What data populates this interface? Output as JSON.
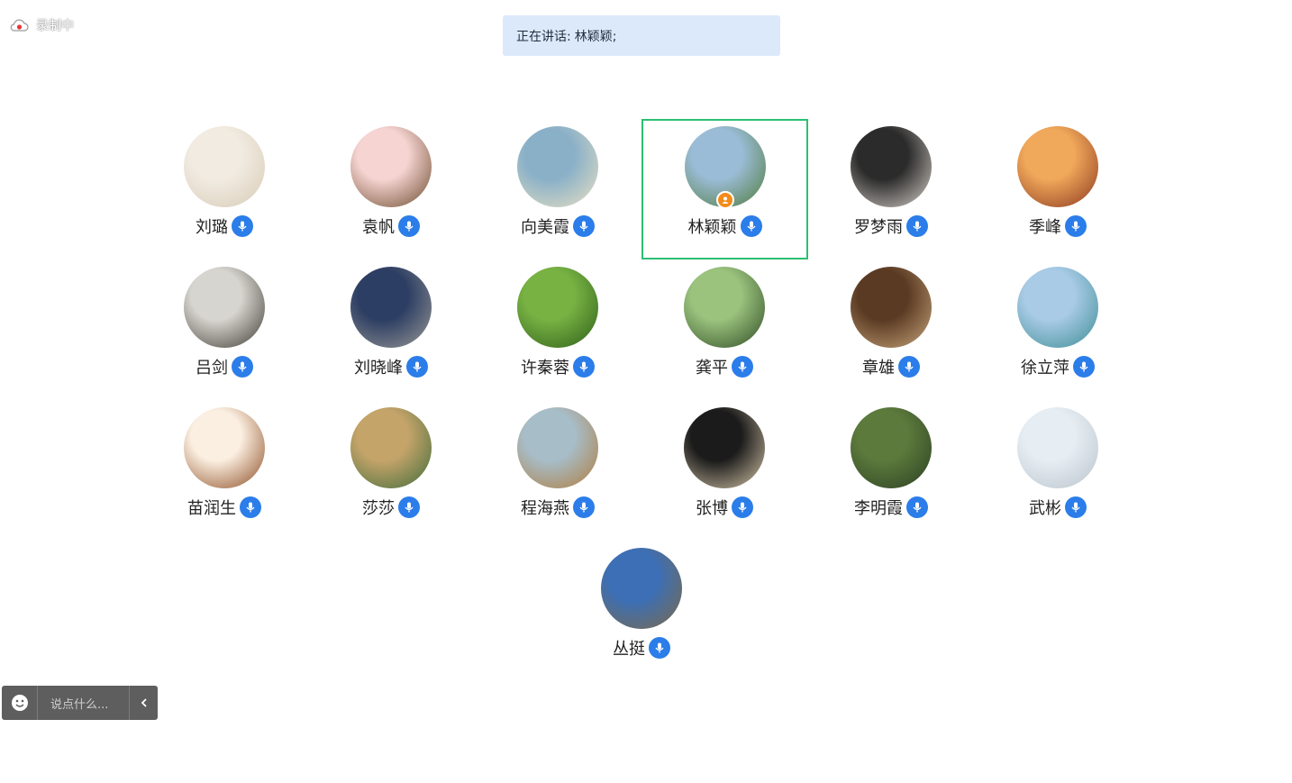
{
  "recording": {
    "label": "录制中",
    "icon": "cloud-record-icon"
  },
  "speaking": {
    "prefix": "正在讲话:",
    "names": "林颖颖;"
  },
  "participants": [
    {
      "name": "刘璐",
      "mic": "on",
      "colors": [
        "#f1ebe1",
        "#d8cbb6"
      ]
    },
    {
      "name": "袁帆",
      "mic": "on",
      "colors": [
        "#f6d4d2",
        "#6b4a2c"
      ]
    },
    {
      "name": "向美霞",
      "mic": "on",
      "colors": [
        "#8ab0c8",
        "#e9e1c2"
      ]
    },
    {
      "name": "林颖颖",
      "mic": "on",
      "host": true,
      "active": true,
      "colors": [
        "#9bbcd6",
        "#4e7a3a"
      ]
    },
    {
      "name": "罗梦雨",
      "mic": "on",
      "colors": [
        "#2b2b2b",
        "#d9d2cb"
      ]
    },
    {
      "name": "季峰",
      "mic": "on",
      "colors": [
        "#f0a85a",
        "#8a3720"
      ]
    },
    {
      "name": "吕剑",
      "mic": "on",
      "colors": [
        "#d7d5cf",
        "#3d3a32"
      ]
    },
    {
      "name": "刘晓峰",
      "mic": "on",
      "colors": [
        "#2c3e63",
        "#9c9a96"
      ]
    },
    {
      "name": "许秦蓉",
      "mic": "on",
      "colors": [
        "#78b243",
        "#2d5e1a"
      ]
    },
    {
      "name": "龚平",
      "mic": "on",
      "colors": [
        "#9bc37e",
        "#2e4a24"
      ]
    },
    {
      "name": "章雄",
      "mic": "on",
      "colors": [
        "#5a3a22",
        "#c9a77e"
      ]
    },
    {
      "name": "徐立萍",
      "mic": "on",
      "colors": [
        "#a9cbe6",
        "#3b8c93"
      ]
    },
    {
      "name": "苗润生",
      "mic": "on",
      "colors": [
        "#fbefe1",
        "#8a4a20"
      ]
    },
    {
      "name": "莎莎",
      "mic": "on",
      "colors": [
        "#c5a46a",
        "#3e6b3a"
      ]
    },
    {
      "name": "程海燕",
      "mic": "on",
      "colors": [
        "#a7bdc8",
        "#b07c3c"
      ]
    },
    {
      "name": "张博",
      "mic": "on",
      "colors": [
        "#1b1b1b",
        "#d9c8ab"
      ]
    },
    {
      "name": "李明霞",
      "mic": "on",
      "colors": [
        "#5c7a3c",
        "#2c3f23"
      ]
    },
    {
      "name": "武彬",
      "mic": "on",
      "colors": [
        "#e6eef3",
        "#b9c3cb"
      ]
    },
    {
      "name": "丛挺",
      "mic": "on",
      "colors": [
        "#3c6fb6",
        "#7c6a47"
      ]
    }
  ],
  "chat": {
    "placeholder": "说点什么...",
    "emoji_icon": "smiley-icon",
    "collapse_icon": "chevron-left-icon"
  },
  "colors": {
    "active_border": "#2cbf73",
    "mic": "#2b7de9",
    "host_badge": "#f38b1a",
    "speaking_bg": "#dce9fb"
  }
}
